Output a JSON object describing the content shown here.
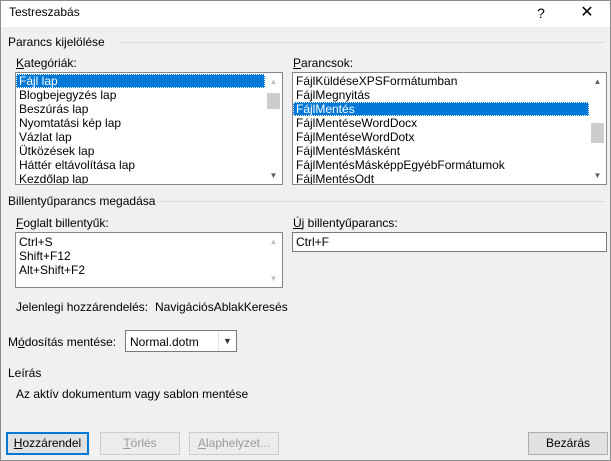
{
  "window": {
    "title": "Testreszabás",
    "help": "?",
    "close": "✕"
  },
  "command_group": {
    "title": "Parancs kijelölése",
    "categories_label": "Kategóriák:",
    "categories": [
      "Fájl lap",
      "Blogbejegyzés lap",
      "Beszúrás lap",
      "Nyomtatási kép lap",
      "Vázlat lap",
      "Ütközések lap",
      "Háttér eltávolítása lap",
      "Kezdőlap lap"
    ],
    "commands_label": "Parancsok:",
    "commands": [
      "FájlKüldéseXPSFormátumban",
      "FájlMegnyitás",
      "FájlMentés",
      "FájlMentéseWordDocx",
      "FájlMentéseWordDotx",
      "FájlMentésMásként",
      "FájlMentésMásképpEgyébFormátumok",
      "FájlMentésOdt"
    ]
  },
  "shortcut_group": {
    "title": "Billentyűparancs megadása",
    "current_keys_label": "Foglalt billentyűk:",
    "current_keys": [
      "Ctrl+S",
      "Shift+F12",
      "Alt+Shift+F2"
    ],
    "new_shortcut_label": "Új billentyűparancs:",
    "new_shortcut_value": "Ctrl+F",
    "current_assignment_label": "Jelenlegi hozzárendelés:",
    "current_assignment_value": "NavigációsAblakKeresés"
  },
  "save_changes": {
    "label": "Módosítás mentése:",
    "value": "Normal.dotm"
  },
  "description": {
    "title": "Leírás",
    "text": "Az aktív dokumentum vagy sablon mentése"
  },
  "buttons": {
    "assign": "Hozzárendel",
    "remove": "Törlés",
    "reset": "Alaphelyzet...",
    "close": "Bezárás"
  },
  "icons": {
    "scroll_up": "▲",
    "scroll_down": "▼",
    "dropdown": "▼"
  }
}
